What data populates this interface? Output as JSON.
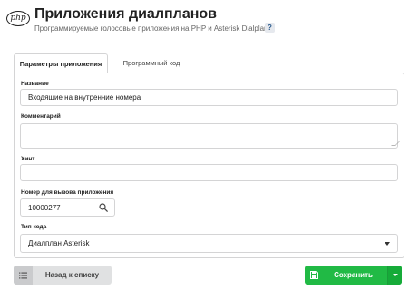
{
  "header": {
    "title": "Приложения диалпланов",
    "subtitle": "Программируемые голосовые приложения на PHP и Asterisk Dialplan",
    "logo_text": "php",
    "help_label": "?"
  },
  "tabs": [
    {
      "label": "Параметры приложения",
      "active": true
    },
    {
      "label": "Программный код",
      "active": false
    }
  ],
  "form": {
    "name": {
      "label": "Название",
      "value": "Входящие на внутренние номера"
    },
    "comment": {
      "label": "Комментарий",
      "value": ""
    },
    "hint": {
      "label": "Хинт",
      "value": ""
    },
    "extension": {
      "label": "Номер для вызова приложения",
      "value": "10000277"
    },
    "type": {
      "label": "Тип кода",
      "value": "Диалплан Asterisk"
    }
  },
  "actions": {
    "back_label": "Назад к списку",
    "save_label": "Сохранить"
  },
  "colors": {
    "save_button": "#21ba45",
    "back_button": "#e0e1e2"
  }
}
